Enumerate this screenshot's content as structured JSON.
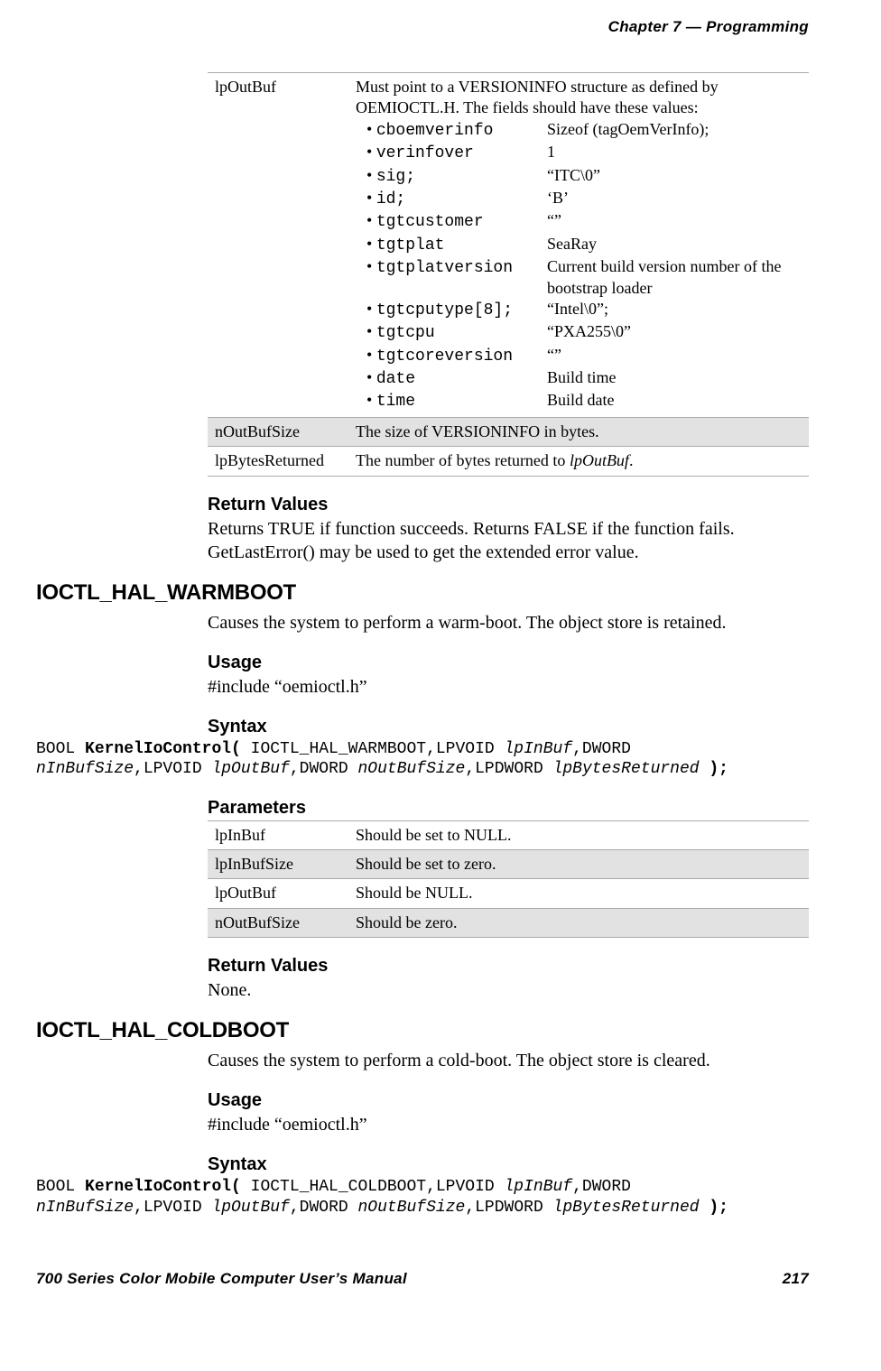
{
  "header": {
    "chapter_label": "Chapter",
    "chapter_num": "7",
    "dash": "—",
    "section": "Programming"
  },
  "table1": {
    "row1": {
      "name": "lpOutBuf",
      "intro": "Must point to a VERSIONINFO structure as defined by OEMIOCTL.H. The fields should have these values:",
      "fields": [
        {
          "k": "cboemverinfo",
          "v": "Sizeof (tagOemVerInfo);"
        },
        {
          "k": "verinfover",
          "v": "1"
        },
        {
          "k": "sig;",
          "v": "“ITC\\0”"
        },
        {
          "k": "id;",
          "v": "‘B’"
        },
        {
          "k": "tgtcustomer",
          "v": "“”"
        },
        {
          "k": "tgtplat",
          "v": "SeaRay"
        },
        {
          "k": "tgtplatversion",
          "v": "Current build version number of the bootstrap loader"
        },
        {
          "k": "tgtcputype[8];",
          "v": "“Intel\\0”;"
        },
        {
          "k": "tgtcpu",
          "v": "“PXA255\\0”"
        },
        {
          "k": "tgtcoreversion",
          "v": "“”"
        },
        {
          "k": "date",
          "v": "Build time"
        },
        {
          "k": "time",
          "v": "Build date"
        }
      ]
    },
    "row2": {
      "name": "nOutBufSize",
      "desc": "The size of VERSIONINFO in bytes."
    },
    "row3": {
      "name": "lpBytesReturned",
      "desc_prefix": "The number of bytes returned to ",
      "desc_em": "lpOutBuf",
      "desc_suffix": "."
    }
  },
  "sec1": {
    "h": "Return Values",
    "body": "Returns TRUE if function succeeds. Returns FALSE if the function fails. GetLastError() may be used to get the extended error value."
  },
  "h2a": "IOCTL_HAL_WARMBOOT",
  "warm": {
    "desc": "Causes the system to perform a warm-boot. The object store is retained.",
    "usage_h": "Usage",
    "usage": "#include “oemioctl.h”",
    "syntax_h": "Syntax",
    "syntax_parts": {
      "p1": "BOOL ",
      "p2": "KernelIoControl(",
      "p3": " IOCTL_HAL_WARMBOOT,LPVOID ",
      "p4": "lpInBuf",
      "p5": ",DWORD\n",
      "p6": "nInBufSize",
      "p7": ",LPVOID ",
      "p8": "lpOutBuf",
      "p9": ",DWORD ",
      "p10": "nOutBufSize",
      "p11": ",LPDWORD ",
      "p12": "lpBytesReturned",
      "p13": " );"
    },
    "params_h": "Parameters",
    "params": [
      {
        "name": "lpInBuf",
        "desc": "Should be set to NULL."
      },
      {
        "name": "lpInBufSize",
        "desc": "Should be set to zero."
      },
      {
        "name": "lpOutBuf",
        "desc": "Should be NULL."
      },
      {
        "name": "nOutBufSize",
        "desc": "Should be zero."
      }
    ],
    "ret_h": "Return Values",
    "ret_body": "None."
  },
  "h2b": "IOCTL_HAL_COLDBOOT",
  "cold": {
    "desc": "Causes the system to perform a cold-boot. The object store is cleared.",
    "usage_h": "Usage",
    "usage": "#include “oemioctl.h”",
    "syntax_h": "Syntax",
    "syntax_parts": {
      "p1": "BOOL ",
      "p2": "KernelIoControl(",
      "p3": " IOCTL_HAL_COLDBOOT,LPVOID ",
      "p4": "lpInBuf",
      "p5": ",DWORD\n",
      "p6": "nInBufSize",
      "p7": ",LPVOID ",
      "p8": "lpOutBuf",
      "p9": ",DWORD ",
      "p10": "nOutBufSize",
      "p11": ",LPDWORD ",
      "p12": "lpBytesReturned",
      "p13": " );"
    }
  },
  "footer": {
    "left": "700 Series Color Mobile Computer User’s Manual",
    "right": "217"
  }
}
